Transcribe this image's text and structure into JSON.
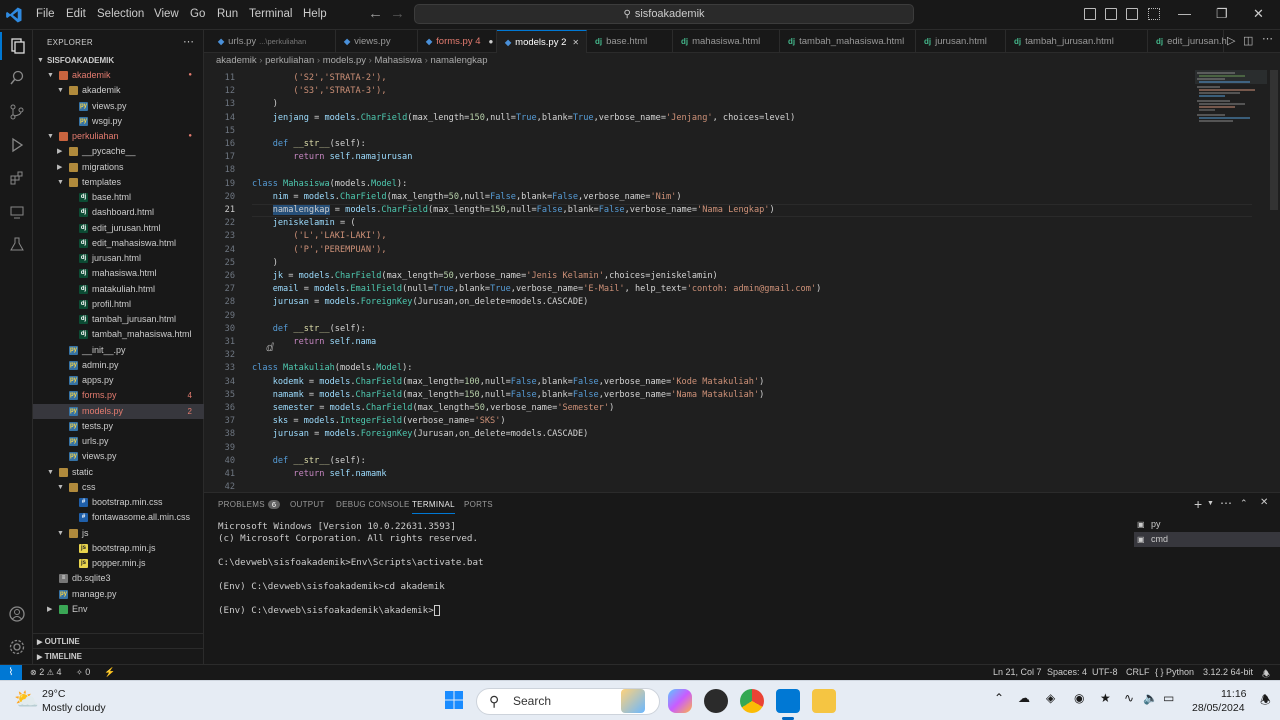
{
  "titlebar": {
    "menu": [
      "File",
      "Edit",
      "Selection",
      "View",
      "Go",
      "Run",
      "Terminal",
      "Help"
    ],
    "search": "sisfoakademik"
  },
  "explorer": {
    "header": "EXPLORER",
    "project": "SISFOAKADEMIK",
    "tree": [
      {
        "label": "akademik",
        "depth": 1,
        "type": "folder",
        "open": true,
        "color": "#e37b6f",
        "dot": true
      },
      {
        "label": "akademik",
        "depth": 2,
        "type": "folder",
        "open": true,
        "color": "#ccc"
      },
      {
        "label": "views.py",
        "depth": 3,
        "type": "py",
        "color": "#ccc"
      },
      {
        "label": "wsgi.py",
        "depth": 3,
        "type": "py",
        "color": "#ccc"
      },
      {
        "label": "perkuliahan",
        "depth": 1,
        "type": "folder",
        "open": true,
        "color": "#e37b6f",
        "dot": true
      },
      {
        "label": "__pycache__",
        "depth": 2,
        "type": "folder",
        "open": false,
        "color": "#ccc"
      },
      {
        "label": "migrations",
        "depth": 2,
        "type": "folder",
        "open": false,
        "color": "#ccc"
      },
      {
        "label": "templates",
        "depth": 2,
        "type": "folder",
        "open": true,
        "color": "#ccc"
      },
      {
        "label": "base.html",
        "depth": 3,
        "type": "dj",
        "color": "#ccc"
      },
      {
        "label": "dashboard.html",
        "depth": 3,
        "type": "dj",
        "color": "#ccc"
      },
      {
        "label": "edit_jurusan.html",
        "depth": 3,
        "type": "dj",
        "color": "#ccc"
      },
      {
        "label": "edit_mahasiswa.html",
        "depth": 3,
        "type": "dj",
        "color": "#ccc"
      },
      {
        "label": "jurusan.html",
        "depth": 3,
        "type": "dj",
        "color": "#ccc"
      },
      {
        "label": "mahasiswa.html",
        "depth": 3,
        "type": "dj",
        "color": "#ccc"
      },
      {
        "label": "matakuliah.html",
        "depth": 3,
        "type": "dj",
        "color": "#ccc"
      },
      {
        "label": "profil.html",
        "depth": 3,
        "type": "dj",
        "color": "#ccc"
      },
      {
        "label": "tambah_jurusan.html",
        "depth": 3,
        "type": "dj",
        "color": "#ccc"
      },
      {
        "label": "tambah_mahasiswa.html",
        "depth": 3,
        "type": "dj",
        "color": "#ccc"
      },
      {
        "label": "__init__.py",
        "depth": 2,
        "type": "py",
        "color": "#ccc"
      },
      {
        "label": "admin.py",
        "depth": 2,
        "type": "py",
        "color": "#ccc"
      },
      {
        "label": "apps.py",
        "depth": 2,
        "type": "py",
        "color": "#ccc"
      },
      {
        "label": "forms.py",
        "depth": 2,
        "type": "py",
        "color": "#e37b6f",
        "badge": "4"
      },
      {
        "label": "models.py",
        "depth": 2,
        "type": "py",
        "color": "#e37b6f",
        "badge": "2",
        "selected": true
      },
      {
        "label": "tests.py",
        "depth": 2,
        "type": "py",
        "color": "#ccc"
      },
      {
        "label": "urls.py",
        "depth": 2,
        "type": "py",
        "color": "#ccc"
      },
      {
        "label": "views.py",
        "depth": 2,
        "type": "py",
        "color": "#ccc"
      },
      {
        "label": "static",
        "depth": 1,
        "type": "folder",
        "open": true,
        "color": "#ccc"
      },
      {
        "label": "css",
        "depth": 2,
        "type": "folder",
        "open": true,
        "color": "#ccc"
      },
      {
        "label": "bootstrap.min.css",
        "depth": 3,
        "type": "css",
        "color": "#ccc"
      },
      {
        "label": "fontawasome.all.min.css",
        "depth": 3,
        "type": "css",
        "color": "#ccc"
      },
      {
        "label": "js",
        "depth": 2,
        "type": "folder",
        "open": true,
        "color": "#ccc"
      },
      {
        "label": "bootstrap.min.js",
        "depth": 3,
        "type": "js",
        "color": "#ccc"
      },
      {
        "label": "popper.min.js",
        "depth": 3,
        "type": "js",
        "color": "#ccc"
      },
      {
        "label": "db.sqlite3",
        "depth": 1,
        "type": "db",
        "color": "#ccc"
      },
      {
        "label": "manage.py",
        "depth": 1,
        "type": "py",
        "color": "#ccc"
      },
      {
        "label": "Env",
        "depth": 1,
        "type": "folder",
        "open": false,
        "color": "#ccc",
        "env": true
      }
    ],
    "outline": "OUTLINE",
    "timeline": "TIMELINE"
  },
  "tabs": [
    {
      "label": "urls.py",
      "sub": "...\\perkuliahan",
      "icon": "py",
      "color": "#999"
    },
    {
      "label": "views.py",
      "icon": "py",
      "color": "#999"
    },
    {
      "label": "forms.py 4",
      "icon": "py",
      "color": "#e37b6f",
      "dot": true
    },
    {
      "label": "models.py 2",
      "icon": "py",
      "color": "#e37b6f",
      "active": true
    },
    {
      "label": "base.html",
      "icon": "dj",
      "color": "#999"
    },
    {
      "label": "mahasiswa.html",
      "icon": "dj",
      "color": "#999"
    },
    {
      "label": "tambah_mahasiswa.html",
      "icon": "dj",
      "color": "#999"
    },
    {
      "label": "jurusan.html",
      "icon": "dj",
      "color": "#999"
    },
    {
      "label": "tambah_jurusan.html",
      "icon": "dj",
      "color": "#999"
    },
    {
      "label": "edit_jurusan.h",
      "icon": "dj",
      "color": "#999"
    }
  ],
  "breadcrumb": [
    "akademik",
    "perkuliahan",
    "models.py",
    "Mahasiswa",
    "namalengkap"
  ],
  "code": [
    {
      "n": "11",
      "t": [
        [
          "        ('S2','STRATA-2'),",
          "str"
        ]
      ]
    },
    {
      "n": "12",
      "t": [
        [
          "        ('S3','STRATA-3'),",
          "str"
        ]
      ]
    },
    {
      "n": "13",
      "t": [
        [
          "    )",
          "pl"
        ]
      ]
    },
    {
      "n": "14",
      "t": [
        [
          "    jenjang",
          "var"
        ],
        [
          " = ",
          "pl"
        ],
        [
          "models",
          "var"
        ],
        [
          ".",
          "pl"
        ],
        [
          "CharField",
          "cls"
        ],
        [
          "(max_length=",
          "pl"
        ],
        [
          "150",
          "num"
        ],
        [
          ",null=",
          "pl"
        ],
        [
          "True",
          "kw"
        ],
        [
          ",blank=",
          "pl"
        ],
        [
          "True",
          "kw"
        ],
        [
          ",verbose_name=",
          "pl"
        ],
        [
          "'Jenjang'",
          "str"
        ],
        [
          ", choices=level)",
          "pl"
        ]
      ]
    },
    {
      "n": "15",
      "t": [
        [
          "",
          "pl"
        ]
      ]
    },
    {
      "n": "16",
      "t": [
        [
          "    def ",
          "kw"
        ],
        [
          "__str__",
          "fn"
        ],
        [
          "(self):",
          "pl"
        ]
      ]
    },
    {
      "n": "17",
      "t": [
        [
          "        return ",
          "kw2"
        ],
        [
          "self.namajurusan",
          "var"
        ]
      ]
    },
    {
      "n": "18",
      "t": [
        [
          "",
          "pl"
        ]
      ]
    },
    {
      "n": "19",
      "t": [
        [
          "class ",
          "kw"
        ],
        [
          "Mahasiswa",
          "cls"
        ],
        [
          "(models.",
          "pl"
        ],
        [
          "Model",
          "cls"
        ],
        [
          "):",
          "pl"
        ]
      ]
    },
    {
      "n": "20",
      "t": [
        [
          "    nim",
          "var"
        ],
        [
          " = ",
          "pl"
        ],
        [
          "models",
          "var"
        ],
        [
          ".",
          "pl"
        ],
        [
          "CharField",
          "cls"
        ],
        [
          "(max_length=",
          "pl"
        ],
        [
          "50",
          "num"
        ],
        [
          ",null=",
          "pl"
        ],
        [
          "False",
          "kw"
        ],
        [
          ",blank=",
          "pl"
        ],
        [
          "False",
          "kw"
        ],
        [
          ",verbose_name=",
          "pl"
        ],
        [
          "'Nim'",
          "str"
        ],
        [
          ")",
          "pl"
        ]
      ]
    },
    {
      "n": "21",
      "cur": true,
      "t": [
        [
          "    ",
          "pl"
        ],
        [
          "namalengkap",
          "sel"
        ],
        [
          " = ",
          "pl"
        ],
        [
          "models",
          "var"
        ],
        [
          ".",
          "pl"
        ],
        [
          "CharField",
          "cls"
        ],
        [
          "(max_length=",
          "pl"
        ],
        [
          "150",
          "num"
        ],
        [
          ",null=",
          "pl"
        ],
        [
          "False",
          "kw"
        ],
        [
          ",blank=",
          "pl"
        ],
        [
          "False",
          "kw"
        ],
        [
          ",verbose_name=",
          "pl"
        ],
        [
          "'Nama Lengkap'",
          "str"
        ],
        [
          ")",
          "pl"
        ]
      ]
    },
    {
      "n": "22",
      "t": [
        [
          "    jeniskelamin",
          "var"
        ],
        [
          " = (",
          "pl"
        ]
      ]
    },
    {
      "n": "23",
      "t": [
        [
          "        ('L','LAKI-LAKI'),",
          "str"
        ]
      ]
    },
    {
      "n": "24",
      "t": [
        [
          "        ('P','PEREMPUAN'),",
          "str"
        ]
      ]
    },
    {
      "n": "25",
      "t": [
        [
          "    )",
          "pl"
        ]
      ]
    },
    {
      "n": "26",
      "t": [
        [
          "    jk",
          "var"
        ],
        [
          " = ",
          "pl"
        ],
        [
          "models",
          "var"
        ],
        [
          ".",
          "pl"
        ],
        [
          "CharField",
          "cls"
        ],
        [
          "(max_length=",
          "pl"
        ],
        [
          "50",
          "num"
        ],
        [
          ",verbose_name=",
          "pl"
        ],
        [
          "'Jenis Kelamin'",
          "str"
        ],
        [
          ",choices=jeniskelamin)",
          "pl"
        ]
      ]
    },
    {
      "n": "27",
      "t": [
        [
          "    email",
          "var"
        ],
        [
          " = ",
          "pl"
        ],
        [
          "models",
          "var"
        ],
        [
          ".",
          "pl"
        ],
        [
          "EmailField",
          "cls"
        ],
        [
          "(null=",
          "pl"
        ],
        [
          "True",
          "kw"
        ],
        [
          ",blank=",
          "pl"
        ],
        [
          "True",
          "kw"
        ],
        [
          ",verbose_name=",
          "pl"
        ],
        [
          "'E-Mail'",
          "str"
        ],
        [
          ", help_text=",
          "pl"
        ],
        [
          "'contoh: admin@gmail.com'",
          "str"
        ],
        [
          ")",
          "pl"
        ]
      ]
    },
    {
      "n": "28",
      "t": [
        [
          "    jurusan",
          "var"
        ],
        [
          " = ",
          "pl"
        ],
        [
          "models",
          "var"
        ],
        [
          ".",
          "pl"
        ],
        [
          "ForeignKey",
          "cls"
        ],
        [
          "(Jurusan,on_delete=models.CASCADE)",
          "pl"
        ]
      ]
    },
    {
      "n": "29",
      "t": [
        [
          "",
          "pl"
        ]
      ]
    },
    {
      "n": "30",
      "t": [
        [
          "    def ",
          "kw"
        ],
        [
          "__str__",
          "fn"
        ],
        [
          "(self):",
          "pl"
        ]
      ]
    },
    {
      "n": "31",
      "t": [
        [
          "        return ",
          "kw2"
        ],
        [
          "self.nama",
          "var"
        ]
      ]
    },
    {
      "n": "32",
      "t": [
        [
          "",
          "pl"
        ]
      ]
    },
    {
      "n": "33",
      "t": [
        [
          "class ",
          "kw"
        ],
        [
          "Matakuliah",
          "cls"
        ],
        [
          "(models.",
          "pl"
        ],
        [
          "Model",
          "cls"
        ],
        [
          "):",
          "pl"
        ]
      ]
    },
    {
      "n": "34",
      "t": [
        [
          "    kodemk",
          "var"
        ],
        [
          " = ",
          "pl"
        ],
        [
          "models",
          "var"
        ],
        [
          ".",
          "pl"
        ],
        [
          "CharField",
          "cls"
        ],
        [
          "(max_length=",
          "pl"
        ],
        [
          "100",
          "num"
        ],
        [
          ",null=",
          "pl"
        ],
        [
          "False",
          "kw"
        ],
        [
          ",blank=",
          "pl"
        ],
        [
          "False",
          "kw"
        ],
        [
          ",verbose_name=",
          "pl"
        ],
        [
          "'Kode Matakuliah'",
          "str"
        ],
        [
          ")",
          "pl"
        ]
      ]
    },
    {
      "n": "35",
      "t": [
        [
          "    namamk",
          "var"
        ],
        [
          " = ",
          "pl"
        ],
        [
          "models",
          "var"
        ],
        [
          ".",
          "pl"
        ],
        [
          "CharField",
          "cls"
        ],
        [
          "(max_length=",
          "pl"
        ],
        [
          "150",
          "num"
        ],
        [
          ",null=",
          "pl"
        ],
        [
          "False",
          "kw"
        ],
        [
          ",blank=",
          "pl"
        ],
        [
          "False",
          "kw"
        ],
        [
          ",verbose_name=",
          "pl"
        ],
        [
          "'Nama Matakuliah'",
          "str"
        ],
        [
          ")",
          "pl"
        ]
      ]
    },
    {
      "n": "36",
      "t": [
        [
          "    semester",
          "var"
        ],
        [
          " = ",
          "pl"
        ],
        [
          "models",
          "var"
        ],
        [
          ".",
          "pl"
        ],
        [
          "CharField",
          "cls"
        ],
        [
          "(max_length=",
          "pl"
        ],
        [
          "50",
          "num"
        ],
        [
          ",verbose_name=",
          "pl"
        ],
        [
          "'Semester'",
          "str"
        ],
        [
          ")",
          "pl"
        ]
      ]
    },
    {
      "n": "37",
      "t": [
        [
          "    sks",
          "var"
        ],
        [
          " = ",
          "pl"
        ],
        [
          "models",
          "var"
        ],
        [
          ".",
          "pl"
        ],
        [
          "IntegerField",
          "cls"
        ],
        [
          "(verbose_name=",
          "pl"
        ],
        [
          "'SKS'",
          "str"
        ],
        [
          ")",
          "pl"
        ]
      ]
    },
    {
      "n": "38",
      "t": [
        [
          "    jurusan",
          "var"
        ],
        [
          " = ",
          "pl"
        ],
        [
          "models",
          "var"
        ],
        [
          ".",
          "pl"
        ],
        [
          "ForeignKey",
          "cls"
        ],
        [
          "(Jurusan,on_delete=models.CASCADE)",
          "pl"
        ]
      ]
    },
    {
      "n": "39",
      "t": [
        [
          "",
          "pl"
        ]
      ]
    },
    {
      "n": "40",
      "t": [
        [
          "    def ",
          "kw"
        ],
        [
          "__str__",
          "fn"
        ],
        [
          "(self):",
          "pl"
        ]
      ]
    },
    {
      "n": "41",
      "t": [
        [
          "        return ",
          "kw2"
        ],
        [
          "self.namamk",
          "var"
        ]
      ]
    },
    {
      "n": "42",
      "t": [
        [
          "",
          "pl"
        ]
      ]
    }
  ],
  "panel": {
    "tabs": [
      "PROBLEMS",
      "OUTPUT",
      "DEBUG CONSOLE",
      "TERMINAL",
      "PORTS"
    ],
    "problems_count": "6",
    "terminal_lines": [
      "Microsoft Windows [Version 10.0.22631.3593]",
      "(c) Microsoft Corporation. All rights reserved.",
      "",
      "C:\\devweb\\sisfoakademik>Env\\Scripts\\activate.bat",
      "",
      "(Env) C:\\devweb\\sisfoakademik>cd akademik",
      "",
      "(Env) C:\\devweb\\sisfoakademik\\akademik>"
    ],
    "terminals": [
      "py",
      "cmd"
    ]
  },
  "status": {
    "errors": "2",
    "warnings": "4",
    "ports": "0",
    "position": "Ln 21, Col 7",
    "spaces": "Spaces: 4",
    "encoding": "UTF-8",
    "eol": "CRLF",
    "language": "Python",
    "interpreter": "3.12.2 64-bit"
  },
  "taskbar": {
    "weather_temp": "29°C",
    "weather_desc": "Mostly cloudy",
    "search": "Search",
    "time": "11:16",
    "date": "28/05/2024"
  }
}
